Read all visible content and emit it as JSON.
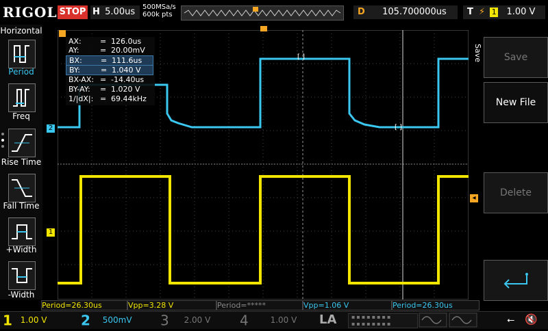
{
  "top": {
    "brand": "RIGOL",
    "run_state": "STOP",
    "timebase_key": "H",
    "timebase": "5.00us",
    "sample_rate": "500MSa/s",
    "mem_depth": "600k pts",
    "delay_key": "D",
    "delay": "105.700000us",
    "trigger_key": "T",
    "trigger_source": "1",
    "trigger_level": "1.00 V"
  },
  "left_menu": {
    "title": "Horizontal",
    "items": [
      {
        "label": "Period"
      },
      {
        "label": "Freq"
      },
      {
        "label": "Rise Time"
      },
      {
        "label": "Fall Time"
      },
      {
        "label": "+Width"
      },
      {
        "label": "-Width"
      }
    ]
  },
  "right_menu": {
    "section": "Save",
    "buttons": [
      "Save",
      "New File",
      "Delete"
    ]
  },
  "cursor_readout": [
    {
      "key": "AX:",
      "value": "126.0us"
    },
    {
      "key": "AY:",
      "value": "20.00mV"
    },
    {
      "key": "BX:",
      "value": "111.6us"
    },
    {
      "key": "BY:",
      "value": "1.040 V"
    },
    {
      "key": "BX-AX:",
      "value": "-14.40us"
    },
    {
      "key": "BY-AY:",
      "value": "1.020 V"
    },
    {
      "key": "1/|dX|:",
      "value": "69.44kHz"
    }
  ],
  "measurements": [
    {
      "text": "Period=26.30us",
      "color": "#f2e600"
    },
    {
      "text": "Vpp=3.28 V",
      "color": "#f2e600"
    },
    {
      "text": "Period=*****",
      "color": "#888888"
    },
    {
      "text": "Vpp=1.06 V",
      "color": "#3ac7f0"
    },
    {
      "text": "Period=26.30us",
      "color": "#3ac7f0"
    }
  ],
  "channels": [
    {
      "num": "1",
      "scale": "1.00 V",
      "color": "#f2e600"
    },
    {
      "num": "2",
      "scale": "500mV",
      "color": "#3ac7f0"
    },
    {
      "num": "3",
      "scale": "2.00 V",
      "color": "#777777"
    },
    {
      "num": "4",
      "scale": "1.00 V",
      "color": "#777777"
    }
  ],
  "la": "LA",
  "markers": {
    "ch2": "2",
    "ch1": "1"
  },
  "colors": {
    "ch1": "#f2e600",
    "ch2": "#3ac7f0",
    "trigger": "#f5a623",
    "stop": "#d9312b"
  }
}
